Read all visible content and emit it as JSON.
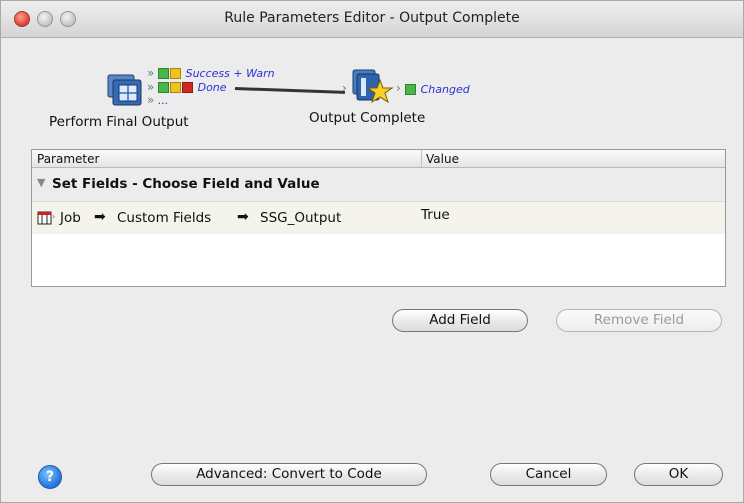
{
  "window": {
    "title": "Rule Parameters Editor - Output Complete"
  },
  "diagram": {
    "source_node": {
      "label": "Perform Final Output",
      "icon": "print-output-icon"
    },
    "branches": [
      {
        "label": "Success + Warn",
        "flags": [
          "green",
          "yellow"
        ]
      },
      {
        "label": "Done",
        "flags": [
          "green",
          "yellow",
          "red"
        ]
      },
      {
        "label": "..."
      }
    ],
    "target_node": {
      "label": "Output Complete",
      "icon": "output-star-icon"
    },
    "target_output": {
      "label": "Changed",
      "flag": "green"
    }
  },
  "table": {
    "columns": [
      "Parameter",
      "Value"
    ],
    "group": {
      "label": "Set Fields - Choose Field and Value"
    },
    "rows": [
      {
        "path": [
          "Job",
          "Custom Fields",
          "SSG_Output"
        ],
        "value": "True"
      }
    ]
  },
  "buttons": {
    "add_field": "Add Field",
    "remove_field": "Remove Field",
    "advanced": "Advanced: Convert to Code",
    "cancel": "Cancel",
    "ok": "OK",
    "help": "?"
  },
  "colors": {
    "branch_label": "#2b30d8",
    "flag_green": "#49b649",
    "flag_yellow": "#f0c21c",
    "flag_red": "#d0281e"
  }
}
